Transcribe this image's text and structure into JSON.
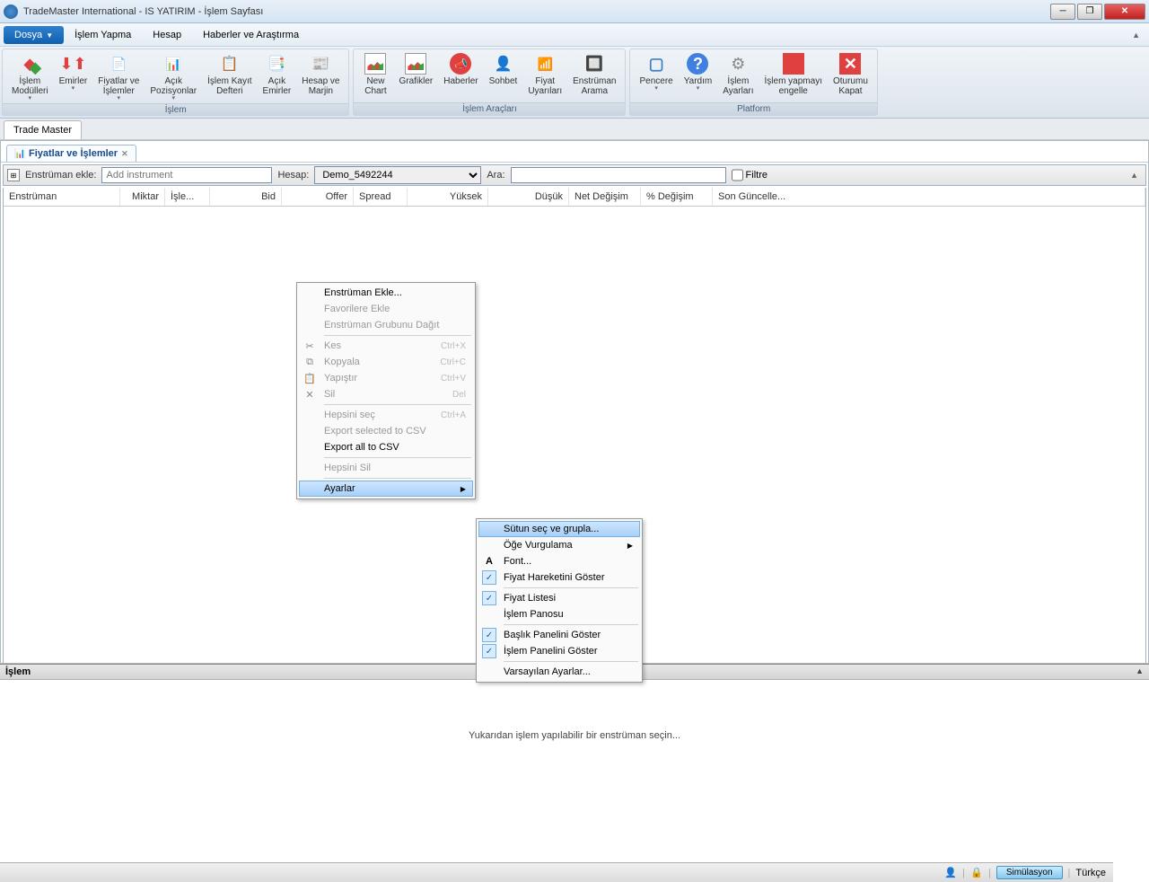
{
  "window": {
    "title": "TradeMaster International - IS YATIRIM - İşlem Sayfası"
  },
  "menu": {
    "items": [
      "Dosya",
      "İşlem Yapma",
      "Hesap",
      "Haberler ve Araştırma"
    ]
  },
  "ribbon": {
    "groups": [
      {
        "label": "İşlem",
        "items": [
          {
            "label": "İşlem\nModülleri",
            "dd": true
          },
          {
            "label": "Emirler",
            "dd": true
          },
          {
            "label": "Fiyatlar ve\nİşlemler",
            "dd": true
          },
          {
            "label": "Açık\nPozisyonlar",
            "dd": true
          },
          {
            "label": "İşlem Kayıt\nDefteri"
          },
          {
            "label": "Açık\nEmirler"
          },
          {
            "label": "Hesap ve\nMarjin"
          }
        ]
      },
      {
        "label": "İşlem Araçları",
        "items": [
          {
            "label": "New\nChart"
          },
          {
            "label": "Grafikler"
          },
          {
            "label": "Haberler"
          },
          {
            "label": "Sohbet"
          },
          {
            "label": "Fiyat\nUyarıları"
          },
          {
            "label": "Enstrüman\nArama"
          }
        ]
      },
      {
        "label": "Platform",
        "items": [
          {
            "label": "Pencere",
            "dd": true
          },
          {
            "label": "Yardım",
            "dd": true
          },
          {
            "label": "İşlem\nAyarları"
          },
          {
            "label": "İşlem yapmayı\nengelle"
          },
          {
            "label": "Oturumu\nKapat"
          }
        ]
      }
    ]
  },
  "doctab": "Trade Master",
  "innertab": "Fiyatlar ve İşlemler",
  "filter": {
    "addinst_label": "Enstrüman ekle:",
    "addinst_placeholder": "Add instrument",
    "hesap_label": "Hesap:",
    "hesap_value": "Demo_5492244",
    "ara_label": "Ara:",
    "filtre_label": "Filtre"
  },
  "grid": {
    "headers": [
      "Enstrüman",
      "Miktar",
      "İşle...",
      "Bid",
      "Offer",
      "Spread",
      "Yüksek",
      "Düşük",
      "Net Değişim",
      "% Değişim",
      "Son Güncelle..."
    ]
  },
  "context_main": [
    {
      "type": "item",
      "label": "Enstrüman Ekle..."
    },
    {
      "type": "item",
      "label": "Favorilere Ekle",
      "disabled": true
    },
    {
      "type": "item",
      "label": "Enstrüman Grubunu Dağıt",
      "disabled": true
    },
    {
      "type": "sep"
    },
    {
      "type": "item",
      "label": "Kes",
      "shortcut": "Ctrl+X",
      "disabled": true,
      "icon": "cut"
    },
    {
      "type": "item",
      "label": "Kopyala",
      "shortcut": "Ctrl+C",
      "disabled": true,
      "icon": "copy"
    },
    {
      "type": "item",
      "label": "Yapıştır",
      "shortcut": "Ctrl+V",
      "disabled": true,
      "icon": "paste"
    },
    {
      "type": "item",
      "label": "Sil",
      "shortcut": "Del",
      "disabled": true,
      "icon": "delete"
    },
    {
      "type": "sep"
    },
    {
      "type": "item",
      "label": "Hepsini seç",
      "shortcut": "Ctrl+A",
      "disabled": true
    },
    {
      "type": "item",
      "label": "Export selected to CSV",
      "disabled": true
    },
    {
      "type": "item",
      "label": "Export all to CSV"
    },
    {
      "type": "sep"
    },
    {
      "type": "item",
      "label": "Hepsini Sil",
      "disabled": true
    },
    {
      "type": "sep"
    },
    {
      "type": "item",
      "label": "Ayarlar",
      "sub": true,
      "hover": true
    }
  ],
  "context_sub": [
    {
      "type": "item",
      "label": "Sütun seç ve grupla...",
      "hover": true
    },
    {
      "type": "item",
      "label": "Öğe Vurgulama",
      "sub": true
    },
    {
      "type": "item",
      "label": "Font...",
      "icon": "font"
    },
    {
      "type": "item",
      "label": "Fiyat Hareketini Göster",
      "checked": true
    },
    {
      "type": "sep"
    },
    {
      "type": "item",
      "label": "Fiyat Listesi",
      "checked": true
    },
    {
      "type": "item",
      "label": "İşlem Panosu"
    },
    {
      "type": "sep"
    },
    {
      "type": "item",
      "label": "Başlık Panelini Göster",
      "checked": true
    },
    {
      "type": "item",
      "label": "İşlem Panelini Göster",
      "checked": true
    },
    {
      "type": "sep"
    },
    {
      "type": "item",
      "label": "Varsayılan Ayarlar..."
    }
  ],
  "bottom": {
    "title": "İşlem",
    "message": "Yukarıdan işlem yapılabilir bir enstrüman seçin..."
  },
  "status": {
    "sim": "Simülasyon",
    "lang": "Türkçe"
  }
}
